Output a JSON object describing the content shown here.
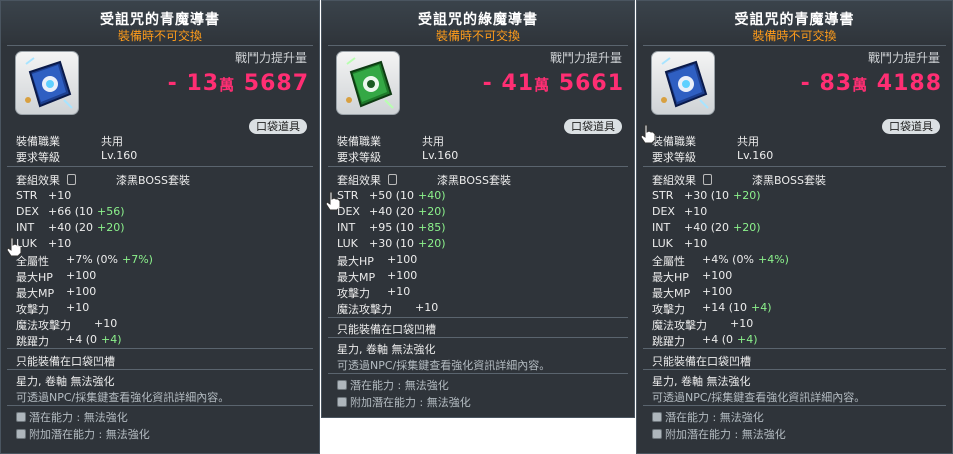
{
  "tooltips": [
    {
      "title": "受詛咒的青魔導書",
      "subtitle": "裝備時不可交換",
      "power_label": "戰鬥力提升量",
      "power_sign": "-",
      "power_wan": "13",
      "power_wan_unit": "萬",
      "power_rest": "5687",
      "pocket_label": "口袋道具",
      "job_label": "裝備職業",
      "job_value": "共用",
      "level_label": "要求等級",
      "level_value": "Lv.160",
      "set_label": "套組效果",
      "set_value": "漆黑BOSS套裝",
      "stats": [
        {
          "k": "STR",
          "v": "+10",
          "extra": ""
        },
        {
          "k": "DEX",
          "v": "+66 (10",
          "extra": "+56)"
        },
        {
          "k": "INT",
          "v": "+40 (20",
          "extra": "+20)"
        },
        {
          "k": "LUK",
          "v": "+10",
          "extra": ""
        },
        {
          "k": "全屬性",
          "v": "+7% (0%",
          "extra": "+7%)"
        },
        {
          "k": "最大HP",
          "v": "+100",
          "extra": ""
        },
        {
          "k": "最大MP",
          "v": "+100",
          "extra": ""
        },
        {
          "k": "攻擊力",
          "v": "+10",
          "extra": ""
        },
        {
          "k": "魔法攻擊力",
          "v": "+10",
          "extra": ""
        },
        {
          "k": "跳躍力",
          "v": "+4 (0",
          "extra": "+4)"
        }
      ],
      "pocket_only": "只能裝備在口袋凹槽",
      "star_scroll": "星力, 卷軸 無法強化",
      "npc_note": "可透過NPC/採集鍵查看強化資訊詳細內容。",
      "potential": "潛在能力 : 無法強化",
      "additional_potential": "附加潛在能力 : 無法強化",
      "book_color": "#1d3f8f"
    },
    {
      "title": "受詛咒的綠魔導書",
      "subtitle": "裝備時不可交換",
      "power_label": "戰鬥力提升量",
      "power_sign": "-",
      "power_wan": "41",
      "power_wan_unit": "萬",
      "power_rest": "5661",
      "pocket_label": "口袋道具",
      "job_label": "裝備職業",
      "job_value": "共用",
      "level_label": "要求等級",
      "level_value": "Lv.160",
      "set_label": "套組效果",
      "set_value": "漆黑BOSS套裝",
      "stats": [
        {
          "k": "STR",
          "v": "+50 (10",
          "extra": "+40)"
        },
        {
          "k": "DEX",
          "v": "+40 (20",
          "extra": "+20)"
        },
        {
          "k": "INT",
          "v": "+95 (10",
          "extra": "+85)"
        },
        {
          "k": "LUK",
          "v": "+30 (10",
          "extra": "+20)"
        },
        {
          "k": "最大HP",
          "v": "+100",
          "extra": ""
        },
        {
          "k": "最大MP",
          "v": "+100",
          "extra": ""
        },
        {
          "k": "攻擊力",
          "v": "+10",
          "extra": ""
        },
        {
          "k": "魔法攻擊力",
          "v": "+10",
          "extra": ""
        }
      ],
      "pocket_only": "只能裝備在口袋凹槽",
      "star_scroll": "星力, 卷軸 無法強化",
      "npc_note": "可透過NPC/採集鍵查看強化資訊詳細內容。",
      "potential": "潛在能力 : 無法強化",
      "additional_potential": "附加潛在能力 : 無法強化",
      "book_color": "#1e7a2a"
    },
    {
      "title": "受詛咒的青魔導書",
      "subtitle": "裝備時不可交換",
      "power_label": "戰鬥力提升量",
      "power_sign": "-",
      "power_wan": "83",
      "power_wan_unit": "萬",
      "power_rest": "4188",
      "pocket_label": "口袋道具",
      "job_label": "裝備職業",
      "job_value": "共用",
      "level_label": "要求等級",
      "level_value": "Lv.160",
      "set_label": "套組效果",
      "set_value": "漆黑BOSS套裝",
      "stats": [
        {
          "k": "STR",
          "v": "+30 (10",
          "extra": "+20)"
        },
        {
          "k": "DEX",
          "v": "+10",
          "extra": ""
        },
        {
          "k": "INT",
          "v": "+40 (20",
          "extra": "+20)"
        },
        {
          "k": "LUK",
          "v": "+10",
          "extra": ""
        },
        {
          "k": "全屬性",
          "v": "+4% (0%",
          "extra": "+4%)"
        },
        {
          "k": "最大HP",
          "v": "+100",
          "extra": ""
        },
        {
          "k": "最大MP",
          "v": "+100",
          "extra": ""
        },
        {
          "k": "攻擊力",
          "v": "+14 (10",
          "extra": "+4)"
        },
        {
          "k": "魔法攻擊力",
          "v": "+10",
          "extra": ""
        },
        {
          "k": "跳躍力",
          "v": "+4 (0",
          "extra": "+4)"
        }
      ],
      "pocket_only": "只能裝備在口袋凹槽",
      "star_scroll": "星力, 卷軸 無法強化",
      "npc_note": "可透過NPC/採集鍵查看強化資訊詳細內容。",
      "potential": "潛在能力 : 無法強化",
      "additional_potential": "附加潛在能力 : 無法強化",
      "book_color": "#1d3f8f"
    }
  ],
  "colors": {
    "power": "#ff2e73",
    "subtitle": "#ff9c1a",
    "bonus": "#8cf28c"
  },
  "icons": [
    "book-item-icon",
    "hand-cursor-icon",
    "bullet-icon",
    "set-icon"
  ]
}
